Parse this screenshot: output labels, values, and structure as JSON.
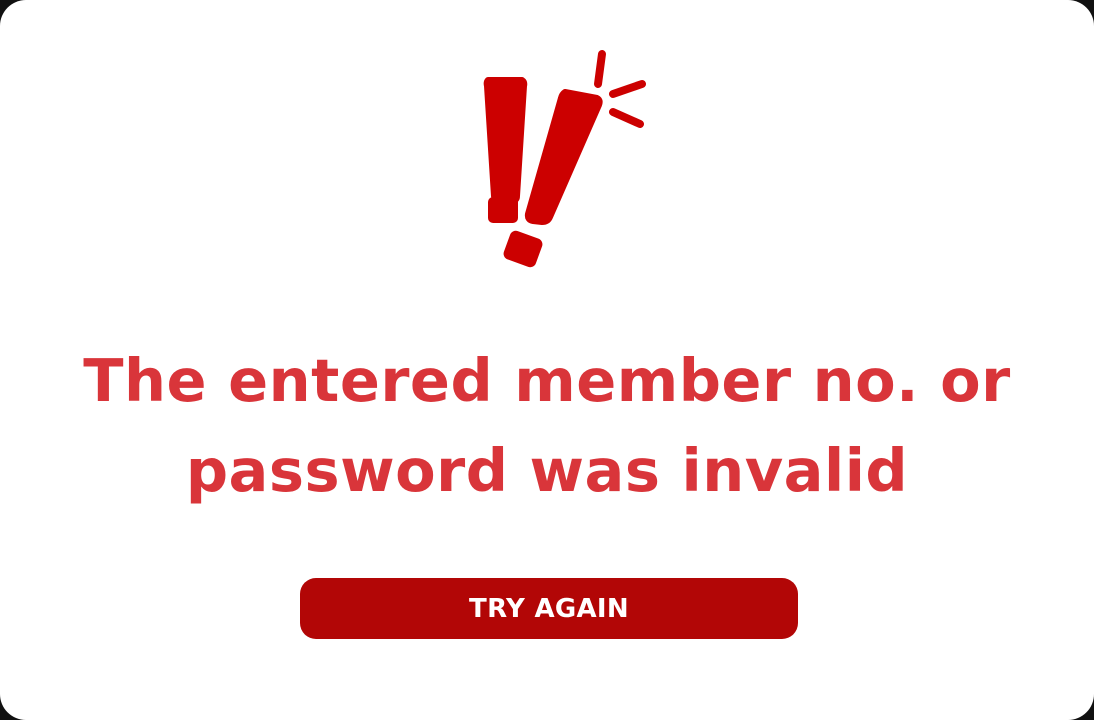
{
  "dialog": {
    "icon": "double-exclamation-alert-icon",
    "message_line1": "The entered member no. or",
    "message_line2": "password was invalid",
    "button_label": "TRY AGAIN"
  },
  "colors": {
    "background": "#ffffff",
    "icon": "#cc0000",
    "message_text": "#d9353a",
    "button_background": "#b20606",
    "button_text": "#ffffff"
  }
}
